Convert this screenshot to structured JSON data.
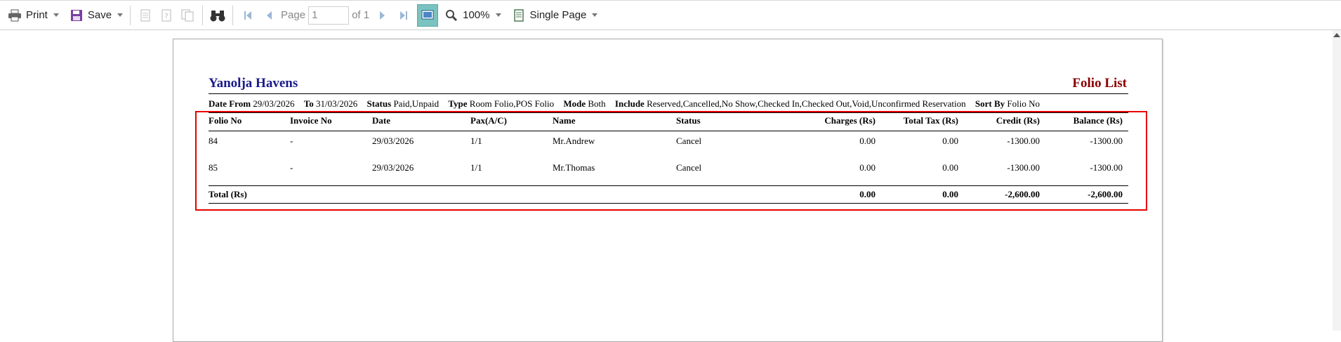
{
  "toolbar": {
    "print_label": "Print",
    "save_label": "Save",
    "page_label": "Page",
    "page_value": "1",
    "of_label": "of 1",
    "zoom_value": "100%",
    "view_mode": "Single Page"
  },
  "report": {
    "company": "Yanolja Havens",
    "title": "Folio List",
    "filters": [
      {
        "label": "Date From",
        "value": "29/03/2026"
      },
      {
        "label": "To",
        "value": "31/03/2026"
      },
      {
        "label": "Status",
        "value": "Paid,Unpaid"
      },
      {
        "label": "Type",
        "value": "Room Folio,POS Folio"
      },
      {
        "label": "Mode",
        "value": "Both"
      },
      {
        "label": "Include",
        "value": "Reserved,Cancelled,No Show,Checked In,Checked Out,Void,Unconfirmed Reservation"
      },
      {
        "label": "Sort By",
        "value": "Folio No"
      }
    ],
    "columns": [
      "Folio No",
      "Invoice No",
      "Date",
      "Pax(A/C)",
      "Name",
      "Status",
      "Charges (Rs)",
      "Total Tax (Rs)",
      "Credit (Rs)",
      "Balance (Rs)"
    ],
    "rows": [
      [
        "84",
        "-",
        "29/03/2026",
        "1/1",
        "Mr.Andrew",
        "Cancel",
        "0.00",
        "0.00",
        "-1300.00",
        "-1300.00"
      ],
      [
        "85",
        "-",
        "29/03/2026",
        "1/1",
        "Mr.Thomas",
        "Cancel",
        "0.00",
        "0.00",
        "-1300.00",
        "-1300.00"
      ]
    ],
    "total": {
      "label": "Total (Rs)",
      "charges": "0.00",
      "tax": "0.00",
      "credit": "-2,600.00",
      "balance": "-2,600.00"
    }
  },
  "colors": {
    "company": "#1a1a8c",
    "title": "#8b0000",
    "highlight": "#e60000",
    "active_tool": "#7bc3c0"
  }
}
